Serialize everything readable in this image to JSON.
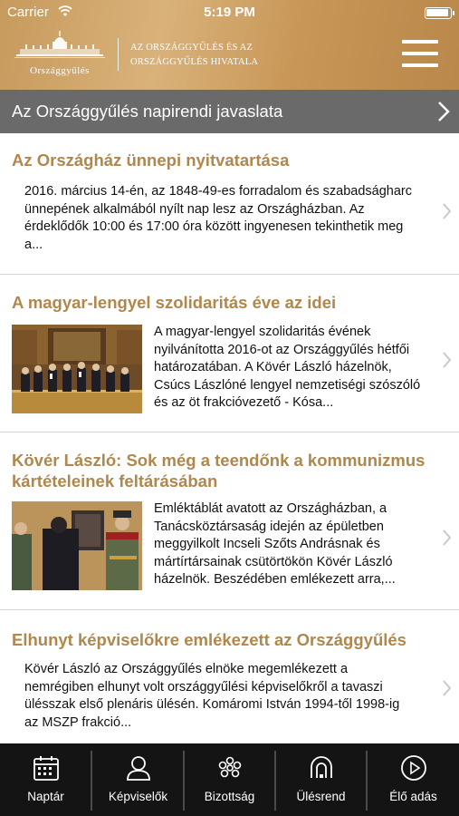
{
  "status_bar": {
    "carrier": "Carrier",
    "time": "5:19 PM"
  },
  "header": {
    "logo_text": "Országgyűlés",
    "title_line1": "AZ ORSZÁGGYŰLÉS ÉS AZ",
    "title_line2": "ORSZÁGGYŰLÉS HIVATALA"
  },
  "agenda": {
    "label": "Az Országgyűlés napirendi javaslata"
  },
  "news": [
    {
      "title": "Az Országház ünnepi nyitvatartása",
      "body_lines": [
        "2016. március 14-én, az 1848-49-es forradalom és szabadságharc",
        "ünnepének alkalmából nyílt nap lesz az Országházban. Az",
        "érdeklődők 10:00 és 17:00 óra között ingyenesen tekinthetik meg",
        "a..."
      ]
    },
    {
      "title": "A magyar-lengyel szolidaritás éve az idei",
      "body_lines": [
        "A magyar-lengyel szolidaritás évének",
        "nyilvánította 2016-ot az Országgyűlés hétfői",
        "határozatában. A Kövér László házelnök,",
        "Csúcs Lászlóné lengyel nemzetiségi szószóló",
        "és az öt frakcióvezető - Kósa..."
      ]
    },
    {
      "title_lines": [
        "Kövér László: Sok még a teendőnk a kommunizmus",
        "kártételeinek feltárásában"
      ],
      "body_lines": [
        "Emléktáblát avatott az Országházban, a",
        "Tanácsköztársaság idején az épületben",
        "meggyilkolt Incseli Szőts Andrásnak és",
        "mártírtársainak csütörtökön Kövér László",
        "házelnök. Beszédében emlékezett arra,..."
      ]
    },
    {
      "title": "Elhunyt képviselőkre emlékezett az Országgyűlés",
      "body_lines": [
        "Kövér László az Országgyűlés elnöke megemlékezett a",
        "nemrégiben elhunyt volt országgyűlési képviselőkről a tavaszi",
        "ülésszak első plenáris ülésén. Komáromi István 1994-től 1998-ig",
        "az MSZP frakció..."
      ]
    }
  ],
  "tabs": [
    {
      "label": "Naptár",
      "icon": "calendar-icon"
    },
    {
      "label": "Képviselők",
      "icon": "person-icon"
    },
    {
      "label": "Bizottság",
      "icon": "committee-icon"
    },
    {
      "label": "Ülésrend",
      "icon": "seating-icon"
    },
    {
      "label": "Élő adás",
      "icon": "play-icon"
    }
  ],
  "colors": {
    "accent": "#b0874c",
    "header_gold": "#c89656",
    "agenda_bar": "#6a6a6a",
    "tabbar": "#141414"
  }
}
